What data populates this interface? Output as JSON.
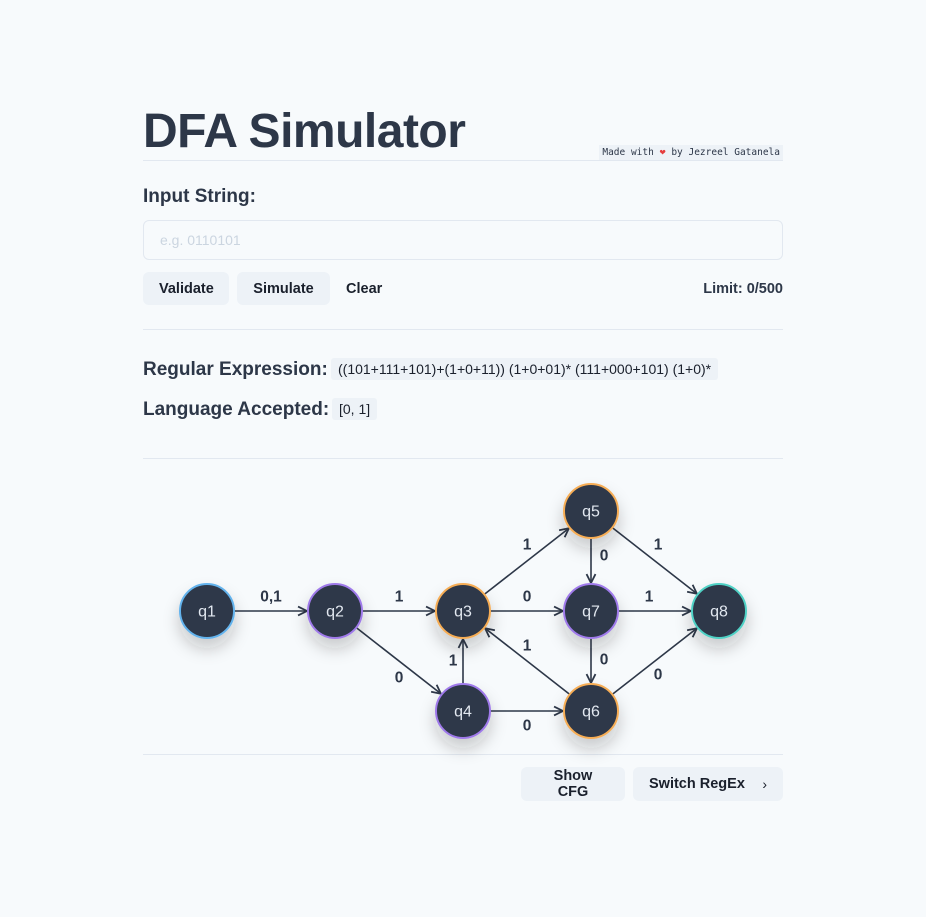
{
  "header": {
    "title": "DFA Simulator",
    "credit_prefix": "Made with",
    "credit_heart": "❤",
    "credit_suffix": "by Jezreel Gatanela"
  },
  "input": {
    "label": "Input String:",
    "placeholder": "e.g. 0110101",
    "value": ""
  },
  "actions": {
    "validate_label": "Validate",
    "simulate_label": "Simulate",
    "clear_label": "Clear",
    "limit_text": "Limit: 0/500"
  },
  "info": {
    "regex_label": "Regular Expression:",
    "regex_value": "((101+111+101)+(1+0+11)) (1+0+01)* (111+000+101) (1+0)*",
    "language_label": "Language Accepted:",
    "language_value": "[0, 1]"
  },
  "diagram": {
    "states": [
      {
        "id": "q1",
        "label": "q1",
        "ring_color": "#63b3ed"
      },
      {
        "id": "q2",
        "label": "q2",
        "ring_color": "#9f7aea"
      },
      {
        "id": "q3",
        "label": "q3",
        "ring_color": "#f6ad55"
      },
      {
        "id": "q4",
        "label": "q4",
        "ring_color": "#9f7aea"
      },
      {
        "id": "q5",
        "label": "q5",
        "ring_color": "#f6ad55"
      },
      {
        "id": "q6",
        "label": "q6",
        "ring_color": "#f6ad55"
      },
      {
        "id": "q7",
        "label": "q7",
        "ring_color": "#9f7aea"
      },
      {
        "id": "q8",
        "label": "q8",
        "ring_color": "#4fd1c5"
      }
    ],
    "transitions": [
      {
        "from": "q1",
        "to": "q2",
        "label": "0,1"
      },
      {
        "from": "q2",
        "to": "q3",
        "label": "1"
      },
      {
        "from": "q2",
        "to": "q4",
        "label": "0"
      },
      {
        "from": "q4",
        "to": "q3",
        "label": "1"
      },
      {
        "from": "q4",
        "to": "q6",
        "label": "0"
      },
      {
        "from": "q3",
        "to": "q5",
        "label": "1"
      },
      {
        "from": "q3",
        "to": "q7",
        "label": "0"
      },
      {
        "from": "q6",
        "to": "q3",
        "label": "1"
      },
      {
        "from": "q5",
        "to": "q7",
        "label": "0"
      },
      {
        "from": "q5",
        "to": "q8",
        "label": "1"
      },
      {
        "from": "q7",
        "to": "q8",
        "label": "1"
      },
      {
        "from": "q7",
        "to": "q6",
        "label": "0"
      },
      {
        "from": "q6",
        "to": "q8",
        "label": "0"
      }
    ]
  },
  "footer": {
    "show_cfg_label": "Show CFG",
    "switch_regex_label": "Switch RegEx",
    "switch_icon": "chevron-right-icon"
  }
}
